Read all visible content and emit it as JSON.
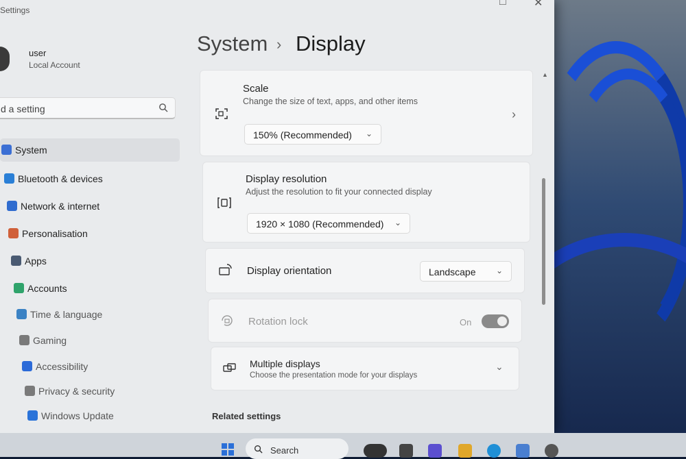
{
  "window": {
    "title": "Settings"
  },
  "user": {
    "name": "user",
    "account_type": "Local Account"
  },
  "search": {
    "placeholder": "d a setting"
  },
  "nav": [
    {
      "label": "System",
      "icon": "system-icon",
      "color": "#3b6fd4",
      "active": true
    },
    {
      "label": "Bluetooth & devices",
      "icon": "bluetooth-icon",
      "color": "#2a7fd6",
      "active": false
    },
    {
      "label": "Network & internet",
      "icon": "wifi-icon",
      "color": "#2f6ccf",
      "active": false
    },
    {
      "label": "Personalisation",
      "icon": "brush-icon",
      "color": "#d0603a",
      "active": false
    },
    {
      "label": "Apps",
      "icon": "apps-icon",
      "color": "#4a5a72",
      "active": false
    },
    {
      "label": "Accounts",
      "icon": "person-icon",
      "color": "#2fa36b",
      "active": false
    },
    {
      "label": "Time & language",
      "icon": "globe-clock-icon",
      "color": "#3b82c4",
      "active": false
    },
    {
      "label": "Gaming",
      "icon": "controller-icon",
      "color": "#7a7a7a",
      "active": false
    },
    {
      "label": "Accessibility",
      "icon": "accessibility-icon",
      "color": "#2b6ad8",
      "active": false
    },
    {
      "label": "Privacy & security",
      "icon": "shield-icon",
      "color": "#7a7a7a",
      "active": false
    },
    {
      "label": "Windows Update",
      "icon": "update-icon",
      "color": "#2a73d9",
      "active": false
    }
  ],
  "breadcrumb": {
    "parent": "System",
    "separator": "›",
    "current": "Display"
  },
  "scale": {
    "title": "Scale",
    "description": "Change the size of text, apps, and other items",
    "value": "150% (Recommended)"
  },
  "resolution": {
    "title": "Display resolution",
    "description": "Adjust the resolution to fit your connected display",
    "value": "1920 × 1080 (Recommended)"
  },
  "orientation": {
    "title": "Display orientation",
    "value": "Landscape"
  },
  "rotation_lock": {
    "title": "Rotation lock",
    "state_label": "On",
    "enabled": false
  },
  "multiple_displays": {
    "title": "Multiple displays",
    "description": "Choose the presentation mode for your displays"
  },
  "related": {
    "heading": "Related settings"
  },
  "taskbar": {
    "search_label": "Search"
  },
  "colors": {
    "accent": "#3b6fd4",
    "wallpaper_bloom": "#1a4fd6"
  }
}
